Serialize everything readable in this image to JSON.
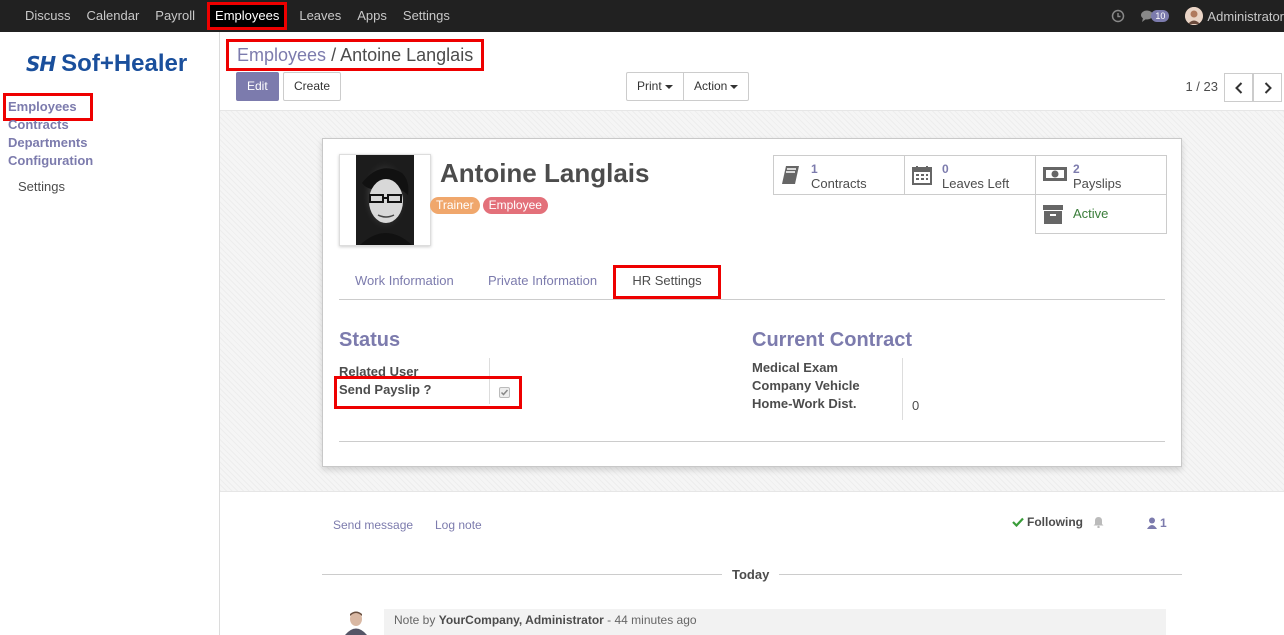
{
  "topbar": {
    "menu": [
      "Discuss",
      "Calendar",
      "Payroll",
      "Employees",
      "Leaves",
      "Apps",
      "Settings"
    ],
    "active_index": 3,
    "messages_count": "10",
    "user_name": "Administrator"
  },
  "sidebar": {
    "logo_mark": "SH",
    "logo_text": "Sof+Healer",
    "items": [
      "Employees",
      "Contracts",
      "Departments",
      "Configuration"
    ],
    "sub_items": [
      "Settings"
    ]
  },
  "breadcrumb": {
    "parent": "Employees",
    "separator": "/",
    "current": "Antoine Langlais"
  },
  "buttons": {
    "edit": "Edit",
    "create": "Create",
    "print": "Print",
    "action": "Action"
  },
  "pager": {
    "text": "1 / 23"
  },
  "employee": {
    "name": "Antoine Langlais",
    "tags": [
      {
        "label": "Trainer",
        "color": "#f0a76c"
      },
      {
        "label": "Employee",
        "color": "#e3707a"
      }
    ]
  },
  "stats": {
    "contracts": {
      "num": "1",
      "label": "Contracts"
    },
    "leaves": {
      "num": "0",
      "label": "Leaves Left"
    },
    "payslips": {
      "num": "2",
      "label": "Payslips"
    },
    "active": {
      "label": "Active"
    }
  },
  "tabs": [
    "Work Information",
    "Private Information",
    "HR Settings"
  ],
  "status": {
    "title": "Status",
    "related_user": "Related User",
    "send_payslip": "Send Payslip ?"
  },
  "contract": {
    "title": "Current Contract",
    "medical_exam": "Medical Exam",
    "company_vehicle": "Company Vehicle",
    "home_work_dist": "Home-Work Dist.",
    "home_work_value": "0"
  },
  "chatter": {
    "send_message": "Send message",
    "log_note": "Log note",
    "following": "Following",
    "followers_count": "1",
    "today": "Today",
    "note_prefix": "Note by",
    "note_author": "YourCompany, Administrator",
    "note_time": "- 44 minutes ago"
  }
}
